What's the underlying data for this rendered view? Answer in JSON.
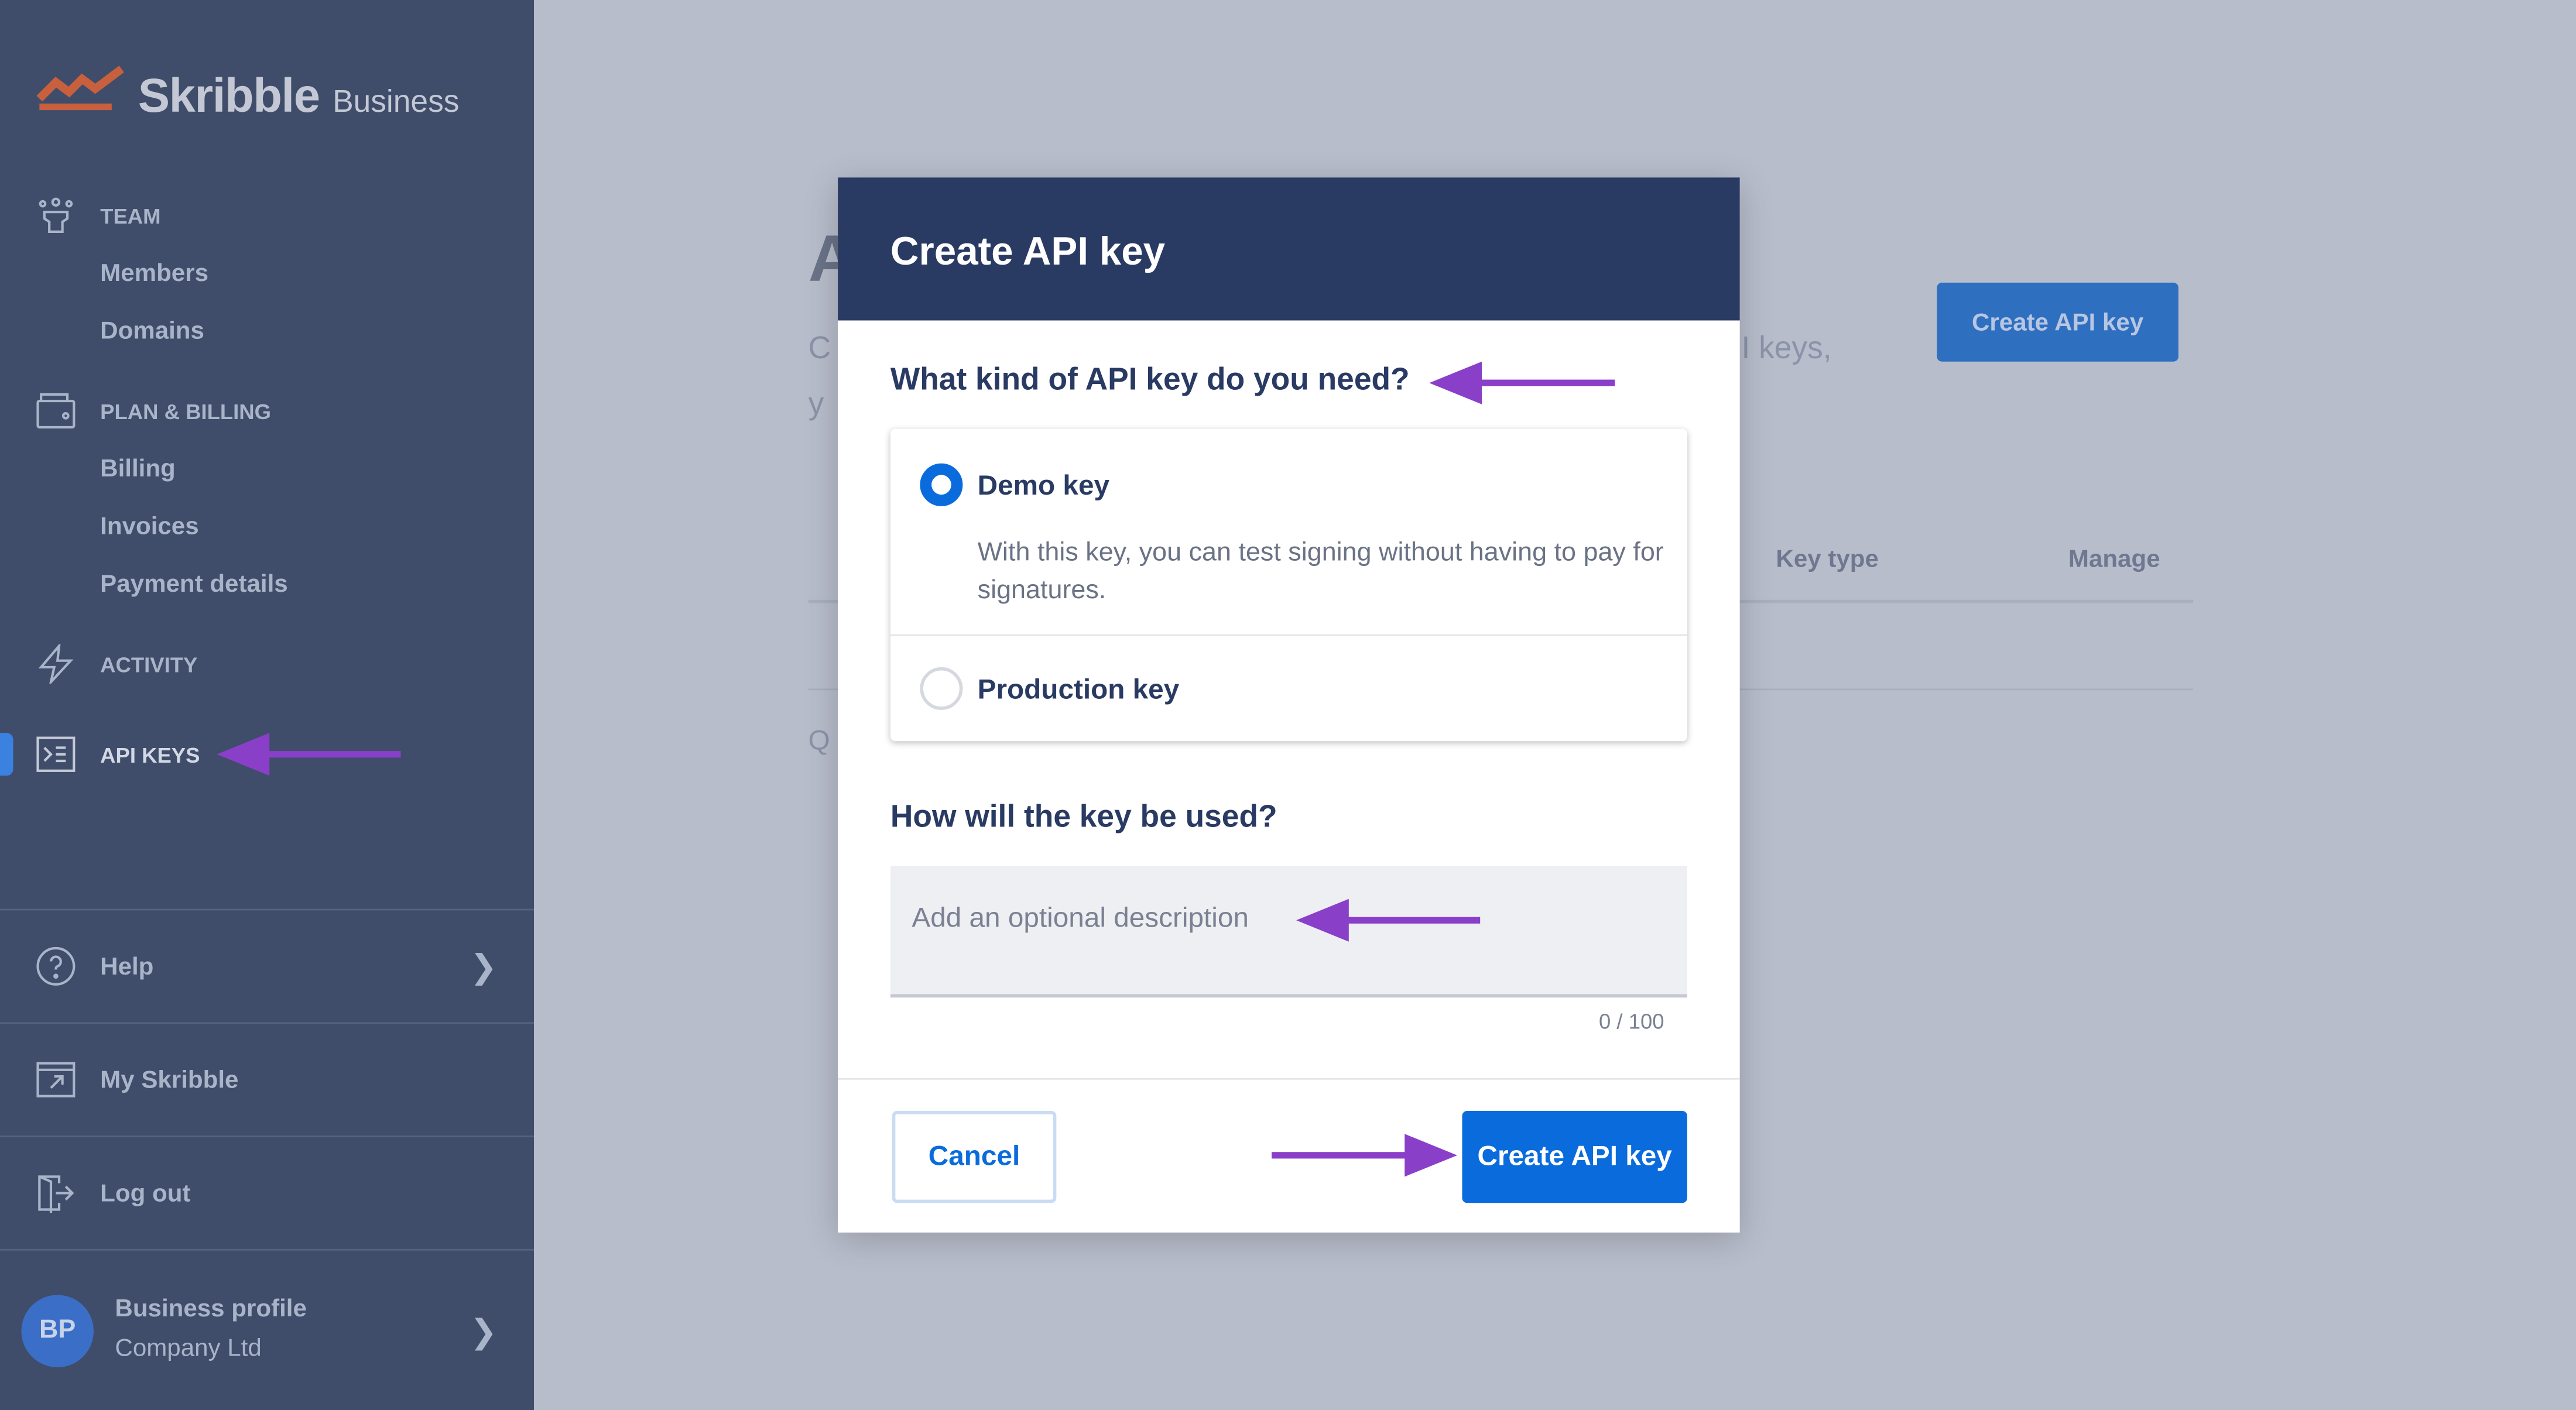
{
  "colors": {
    "sidebar": "#3f4d6b",
    "modal_header": "#293a63",
    "primary": "#0a6cdc",
    "annotation_arrow": "#8a3fc9",
    "logo": "#c8603e"
  },
  "sidebar": {
    "logo": {
      "name": "Skribble",
      "suffix": "Business"
    },
    "sections": [
      {
        "label": "TEAM",
        "icon": "team-icon",
        "items": [
          "Members",
          "Domains"
        ]
      },
      {
        "label": "PLAN & BILLING",
        "icon": "wallet-icon",
        "items": [
          "Billing",
          "Invoices",
          "Payment details"
        ]
      },
      {
        "label": "ACTIVITY",
        "icon": "lightning-icon",
        "items": []
      },
      {
        "label": "API KEYS",
        "icon": "terminal-icon",
        "items": [],
        "active": true
      }
    ],
    "help": "Help",
    "my_skribble": "My Skribble",
    "logout": "Log out",
    "profile": {
      "initials": "BP",
      "name": "Business profile",
      "company": "Company Ltd"
    }
  },
  "background": {
    "title_fragment": "A",
    "desc_fragment_1": "C",
    "desc_fragment_2": "y",
    "desc_fragment_right": "I keys,",
    "create_button": "Create API key",
    "columns": [
      "Key type",
      "Manage"
    ],
    "q_fragment": "Q"
  },
  "modal": {
    "title": "Create API key",
    "question1": "What kind of API key do you need?",
    "options": [
      {
        "label": "Demo key",
        "description": "With this key, you can test signing without having to pay for signatures.",
        "selected": true
      },
      {
        "label": "Production key",
        "selected": false
      }
    ],
    "question2": "How will the key be used?",
    "description_placeholder": "Add an optional description",
    "description_value": "",
    "char_count": "0 / 100",
    "cancel": "Cancel",
    "create": "Create API key"
  }
}
